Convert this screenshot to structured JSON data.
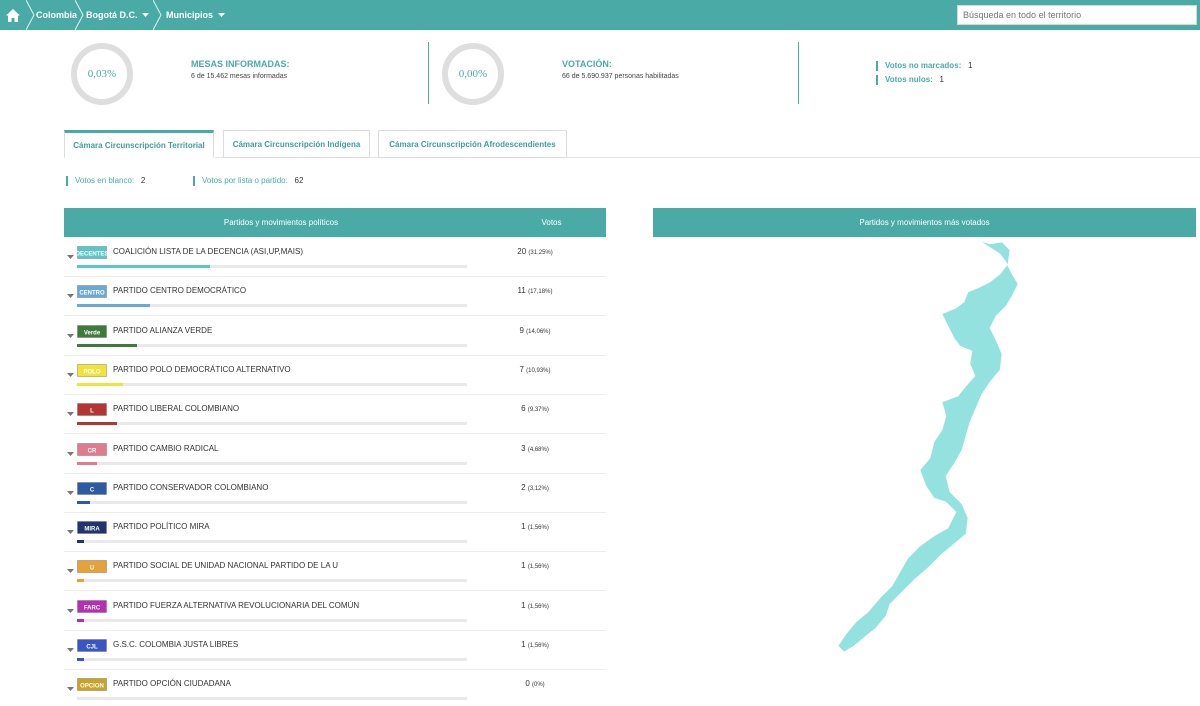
{
  "nav": {
    "breadcrumbs": [
      "Colombia",
      "Bogotá D.C.",
      "Municipios"
    ],
    "search_placeholder": "Búsqueda en todo el territorio"
  },
  "stats": {
    "mesas": {
      "pct": "0,03%",
      "title": "MESAS INFORMADAS:",
      "sub": "6 de 15.462 mesas informadas"
    },
    "votacion": {
      "pct": "0,00%",
      "title": "VOTACIÓN:",
      "sub": "66 de 5.690.937 personas habilitadas"
    },
    "no_marcados": {
      "label": "Votos no marcados:",
      "value": "1"
    },
    "nulos": {
      "label": "Votos nulos:",
      "value": "1"
    }
  },
  "tabs": [
    "Cámara Circunscripción Territorial",
    "Cámara Circunscripción Indígena",
    "Cámara Circunscripción Afrodescendientes"
  ],
  "summary": {
    "blanco": {
      "label": "Votos en blanco:",
      "value": "2"
    },
    "lista": {
      "label": "Votos por lista o partido:",
      "value": "62"
    }
  },
  "table": {
    "col_party": "Partidos y movimientos políticos",
    "col_votes": "Votos",
    "rows": [
      {
        "name": "COALICIÓN LISTA DE LA DECENCIA (ASI,UP,MAIS)",
        "votes": "20",
        "pct": "(31,25%)",
        "share": 0.3125,
        "color": "#5bc6c9",
        "logo": "DECENTES"
      },
      {
        "name": "PARTIDO CENTRO DEMOCRÁTICO",
        "votes": "11",
        "pct": "(17,18%)",
        "share": 0.1718,
        "color": "#6aa9d4",
        "logo": "CENTRO"
      },
      {
        "name": "PARTIDO ALIANZA VERDE",
        "votes": "9",
        "pct": "(14,06%)",
        "share": 0.1406,
        "color": "#3f7a3a",
        "logo": "Verde"
      },
      {
        "name": "PARTIDO POLO DEMOCRÁTICO ALTERNATIVO",
        "votes": "7",
        "pct": "(10,93%)",
        "share": 0.1093,
        "color": "#f0e33c",
        "logo": "POLO"
      },
      {
        "name": "PARTIDO LIBERAL COLOMBIANO",
        "votes": "6",
        "pct": "(9,37%)",
        "share": 0.0937,
        "color": "#b33535",
        "logo": "L"
      },
      {
        "name": "PARTIDO CAMBIO RADICAL",
        "votes": "3",
        "pct": "(4,68%)",
        "share": 0.0468,
        "color": "#e07b8e",
        "logo": "CR"
      },
      {
        "name": "PARTIDO CONSERVADOR COLOMBIANO",
        "votes": "2",
        "pct": "(3,12%)",
        "share": 0.0312,
        "color": "#2d5ba3",
        "logo": "C"
      },
      {
        "name": "PARTIDO POLÍTICO MIRA",
        "votes": "1",
        "pct": "(1,56%)",
        "share": 0.0156,
        "color": "#22346e",
        "logo": "MIRA"
      },
      {
        "name": "PARTIDO SOCIAL DE UNIDAD NACIONAL PARTIDO DE LA U",
        "votes": "1",
        "pct": "(1,56%)",
        "share": 0.0156,
        "color": "#e5a13a",
        "logo": "U"
      },
      {
        "name": "PARTIDO FUERZA ALTERNATIVA REVOLUCIONARIA DEL COMÚN",
        "votes": "1",
        "pct": "(1,56%)",
        "share": 0.0156,
        "color": "#b52fb1",
        "logo": "FARC"
      },
      {
        "name": "G.S.C. COLOMBIA JUSTA LIBRES",
        "votes": "1",
        "pct": "(1,56%)",
        "share": 0.0156,
        "color": "#3a55c4",
        "logo": "CJL"
      },
      {
        "name": "PARTIDO OPCIÓN CIUDADANA",
        "votes": "0",
        "pct": "(0%)",
        "share": 0,
        "color": "#c9a227",
        "logo": "OPCION"
      }
    ]
  },
  "map": {
    "title": "Partidos y movimientos más votados",
    "fill": "#93e2e0"
  },
  "colors": {
    "accent": "#4aaba6"
  }
}
